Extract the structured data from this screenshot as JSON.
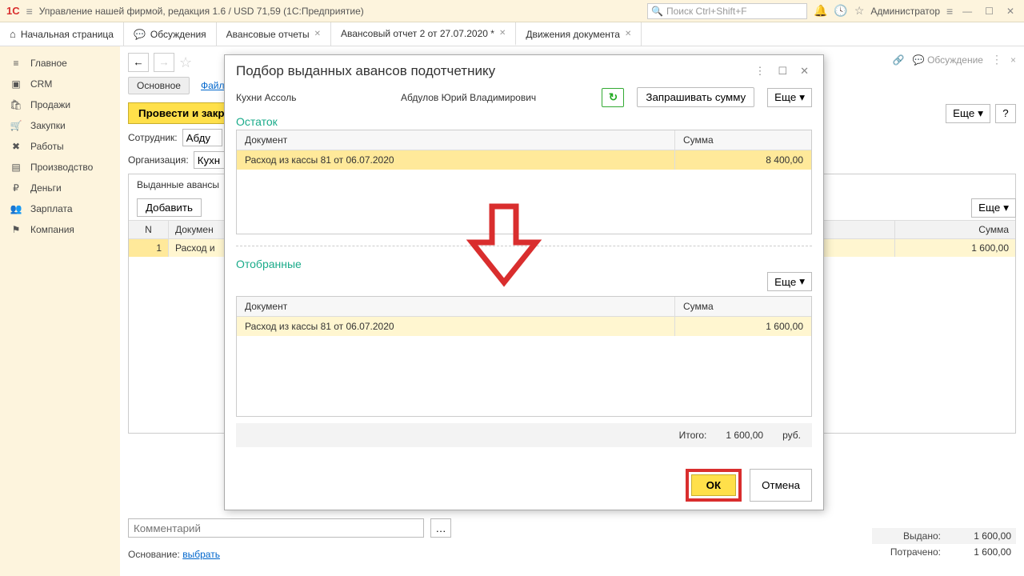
{
  "topbar": {
    "logo": "1C",
    "title": "Управление нашей фирмой, редакция 1.6 / USD 71,59  (1С:Предприятие)",
    "search_placeholder": "Поиск Ctrl+Shift+F",
    "user": "Администратор"
  },
  "tabs": [
    {
      "icon": "home",
      "label": "Начальная страница"
    },
    {
      "icon": "chat",
      "label": "Обсуждения"
    },
    {
      "label": "Авансовые отчеты",
      "close": true
    },
    {
      "label": "Авансовый отчет 2 от 27.07.2020 *",
      "close": true,
      "active": true
    },
    {
      "label": "Движения документа",
      "close": true
    }
  ],
  "sidebar": [
    {
      "ico": "≡",
      "label": "Главное"
    },
    {
      "ico": "▣",
      "label": "CRM"
    },
    {
      "ico": "🛍",
      "label": "Продажи"
    },
    {
      "ico": "🛒",
      "label": "Закупки"
    },
    {
      "ico": "✖",
      "label": "Работы"
    },
    {
      "ico": "▤",
      "label": "Производство"
    },
    {
      "ico": "₽",
      "label": "Деньги"
    },
    {
      "ico": "👥",
      "label": "Зарплата"
    },
    {
      "ico": "⚑",
      "label": "Компания"
    }
  ],
  "content": {
    "sections": {
      "main": "Основное",
      "files": "Файл"
    },
    "process_btn": "Провести и закр",
    "more": "Еще",
    "help": "?",
    "field_emp": "Сотрудник:",
    "field_emp_val": "Абду",
    "field_org": "Организация:",
    "field_org_val": "Кухн",
    "adv_panel": "Выданные авансы",
    "add_btn": "Добавить",
    "col_n": "N",
    "col_doc": "Докумен",
    "col_sum": "Сумма",
    "row_n": "1",
    "row_doc": "Расход и",
    "row_sum": "1 600,00",
    "comment_ph": "Комментарий",
    "basis_lbl": "Основание:",
    "basis_link": "выбрать",
    "issued_lbl": "Выдано:",
    "issued_val": "1 600,00",
    "spent_lbl": "Потрачено:",
    "spent_val": "1 600,00",
    "discussion": "Обсуждение"
  },
  "modal": {
    "title": "Подбор выданных авансов подотчетнику",
    "org": "Кухни Ассоль",
    "emp": "Абдулов Юрий Владимирович",
    "req_btn": "Запрашивать сумму",
    "more": "Еще",
    "section_balance": "Остаток",
    "col_doc": "Документ",
    "col_sum": "Сумма",
    "balance_doc": "Расход из кассы 81 от 06.07.2020",
    "balance_sum": "8 400,00",
    "section_selected": "Отобранные",
    "sel_doc": "Расход из кассы 81 от 06.07.2020",
    "sel_sum": "1 600,00",
    "total_lbl": "Итого:",
    "total_val": "1 600,00",
    "total_cur": "руб.",
    "ok": "ОК",
    "cancel": "Отмена"
  }
}
